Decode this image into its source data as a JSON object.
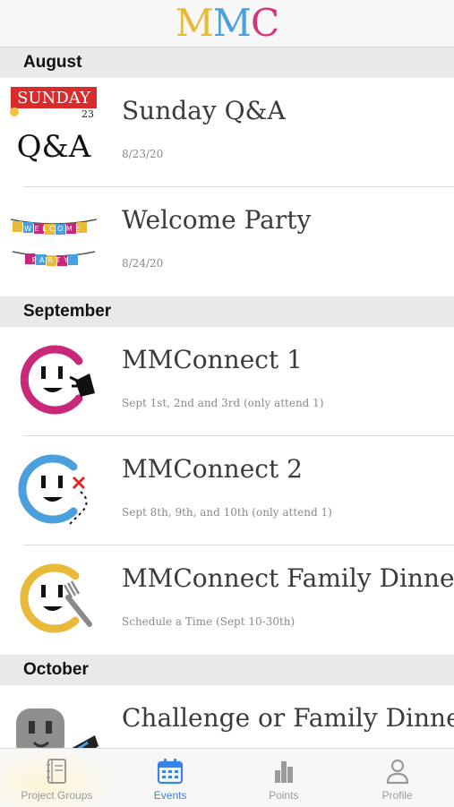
{
  "app": {
    "logo_letters": [
      "M",
      "M",
      "C"
    ],
    "logo_colors": [
      "#e9b93a",
      "#4a9fdc",
      "#d6337a"
    ]
  },
  "sections": [
    {
      "label": "August",
      "events": [
        {
          "title": "Sunday Q&A",
          "subtitle": "8/23/20",
          "thumb": {
            "kind": "sunday-qa",
            "banner": "SUNDAY",
            "day": "23",
            "text": "Q&A"
          }
        },
        {
          "title": "Welcome Party",
          "subtitle": "8/24/20",
          "thumb": {
            "kind": "welcome-party",
            "line1": "WELCOME",
            "line2": "PARTY"
          }
        }
      ]
    },
    {
      "label": "September",
      "events": [
        {
          "title": "MMConnect 1",
          "subtitle": "Sept 1st, 2nd and 3rd (only attend 1)",
          "thumb": {
            "kind": "outlet-plug",
            "color": "#c8287a"
          }
        },
        {
          "title": "MMConnect 2",
          "subtitle": "Sept 8th, 9th, and 10th (only attend 1)",
          "thumb": {
            "kind": "outlet-map",
            "color": "#4a9fdc"
          }
        },
        {
          "title": "MMConnect Family Dinner-",
          "subtitle": "Schedule a Time (Sept 10-30th)",
          "thumb": {
            "kind": "outlet-fork",
            "color": "#e9b93a"
          }
        }
      ]
    },
    {
      "label": "October",
      "events": [
        {
          "title": "Challenge or Family Dinner",
          "subtitle": "",
          "thumb": {
            "kind": "outlet-gray",
            "color": "#9a9a9a"
          }
        }
      ]
    }
  ],
  "tabbar": {
    "active": "Events",
    "tabs": [
      {
        "id": "project-groups",
        "label": "Project Groups",
        "icon": "notebook-icon"
      },
      {
        "id": "events",
        "label": "Events",
        "icon": "calendar-icon"
      },
      {
        "id": "points",
        "label": "Points",
        "icon": "bar-chart-icon"
      },
      {
        "id": "profile",
        "label": "Profile",
        "icon": "person-icon"
      }
    ]
  }
}
